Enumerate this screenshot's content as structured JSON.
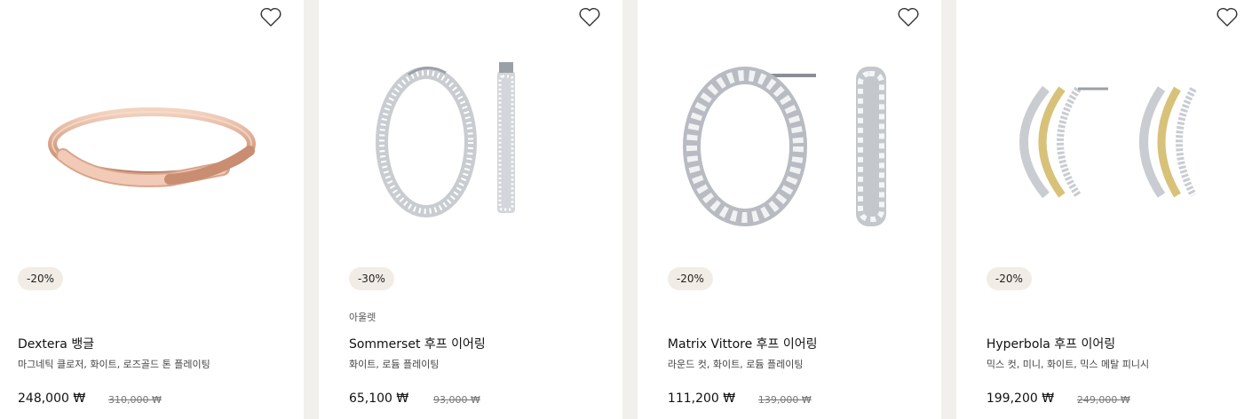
{
  "products": [
    {
      "discount": "-20%",
      "tag": "",
      "name": "Dextera 뱅글",
      "desc": "마그네틱 클로저, 화이트, 로즈골드 톤 플레이팅",
      "price": "248,000 ₩",
      "orig_price": "310,000 ₩",
      "image_icon": "bangle-icon"
    },
    {
      "discount": "-30%",
      "tag": "아울렛",
      "name": "Sommerset 후프 이어링",
      "desc": "화이트, 로듐 플레이팅",
      "price": "65,100 ₩",
      "orig_price": "93,000 ₩",
      "image_icon": "hoop-earring-icon"
    },
    {
      "discount": "-20%",
      "tag": "",
      "name": "Matrix Vittore 후프 이어링",
      "desc": "라운드 컷, 화이트, 로듐 플레이팅",
      "price": "111,200 ₩",
      "orig_price": "139,000 ₩",
      "image_icon": "crystal-hoop-icon"
    },
    {
      "discount": "-20%",
      "tag": "",
      "name": "Hyperbola 후프 이어링",
      "desc": "믹스 컷, 미니, 화이트, 믹스 메탈 피니시",
      "price": "199,200 ₩",
      "orig_price": "249,000 ₩",
      "image_icon": "multi-hoop-icon"
    }
  ],
  "colors": {
    "badge_bg": "#f1ede6",
    "separator": "#f2f0ec",
    "rose_gold": "#d9a48a",
    "silver": "#c9ccd1",
    "gold": "#d8c27a"
  },
  "icons": {
    "wishlist": "heart-outline-icon"
  }
}
